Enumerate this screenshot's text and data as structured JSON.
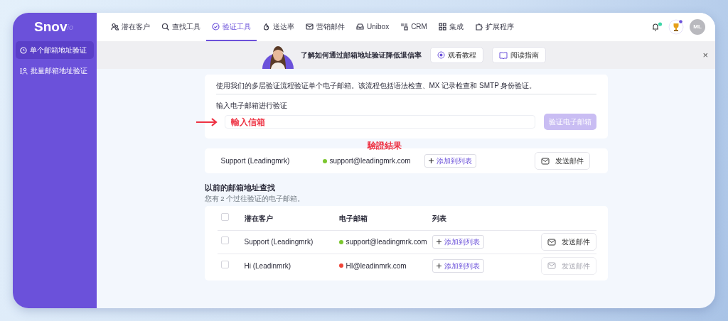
{
  "logo": {
    "name": "Snov",
    "suffix": "io"
  },
  "nav": [
    {
      "label": "潜在客户",
      "selected": false
    },
    {
      "label": "查找工具",
      "selected": false
    },
    {
      "label": "验证工具",
      "selected": true
    },
    {
      "label": "送达率",
      "selected": false
    },
    {
      "label": "营销邮件",
      "selected": false
    },
    {
      "label": "Unibox",
      "selected": false
    },
    {
      "label": "CRM",
      "selected": false
    },
    {
      "label": "集成",
      "selected": false
    },
    {
      "label": "扩展程序",
      "selected": false
    }
  ],
  "avatar": "ML",
  "sidebar": {
    "items": [
      {
        "label": "单个邮箱地址验证",
        "selected": true
      },
      {
        "label": "批量邮箱地址验证",
        "selected": false
      }
    ]
  },
  "banner": {
    "text": "了解如何通过邮箱地址验证降低退信率",
    "buttons": [
      "观看教程",
      "阅读指南"
    ],
    "close": "×"
  },
  "verify": {
    "description": "使用我们的多层验证流程验证单个电子邮箱。该流程包括语法检查、MX 记录检查和 SMTP 身份验证。",
    "label": "输入电子邮箱进行验证",
    "annotation": "輸入信箱",
    "button": {
      "label": "验证电子邮箱",
      "disabled": true
    }
  },
  "result": {
    "annotation": "驗證結果",
    "prospect": "Support (Leadingmrk)",
    "email": "support@leadingmrk.com",
    "color": "#7cc62f",
    "add_button": "添加到列表",
    "send_button": {
      "label": "发送邮件",
      "disabled": false
    }
  },
  "history": {
    "title": "以前的邮箱地址查找",
    "subtitle": "您有 2 个过往验证的电子邮箱。",
    "all_checked": false,
    "columns": [
      "潜在客户",
      "电子邮箱",
      "列表"
    ],
    "rows": [
      {
        "checked": false,
        "prospect": "Support (Leadingmrk)",
        "email": "support@leadingmrk.com",
        "color": "#7cc62f",
        "add_button": "添加到列表",
        "send_button": {
          "label": "发送邮件",
          "disabled": false
        }
      },
      {
        "checked": false,
        "prospect": "Hi (Leadinmrk)",
        "email": "HI@leadinmrk.com",
        "color": "#f04438",
        "add_button": "添加到列表",
        "send_button": {
          "label": "发送邮件",
          "disabled": true
        }
      }
    ]
  }
}
